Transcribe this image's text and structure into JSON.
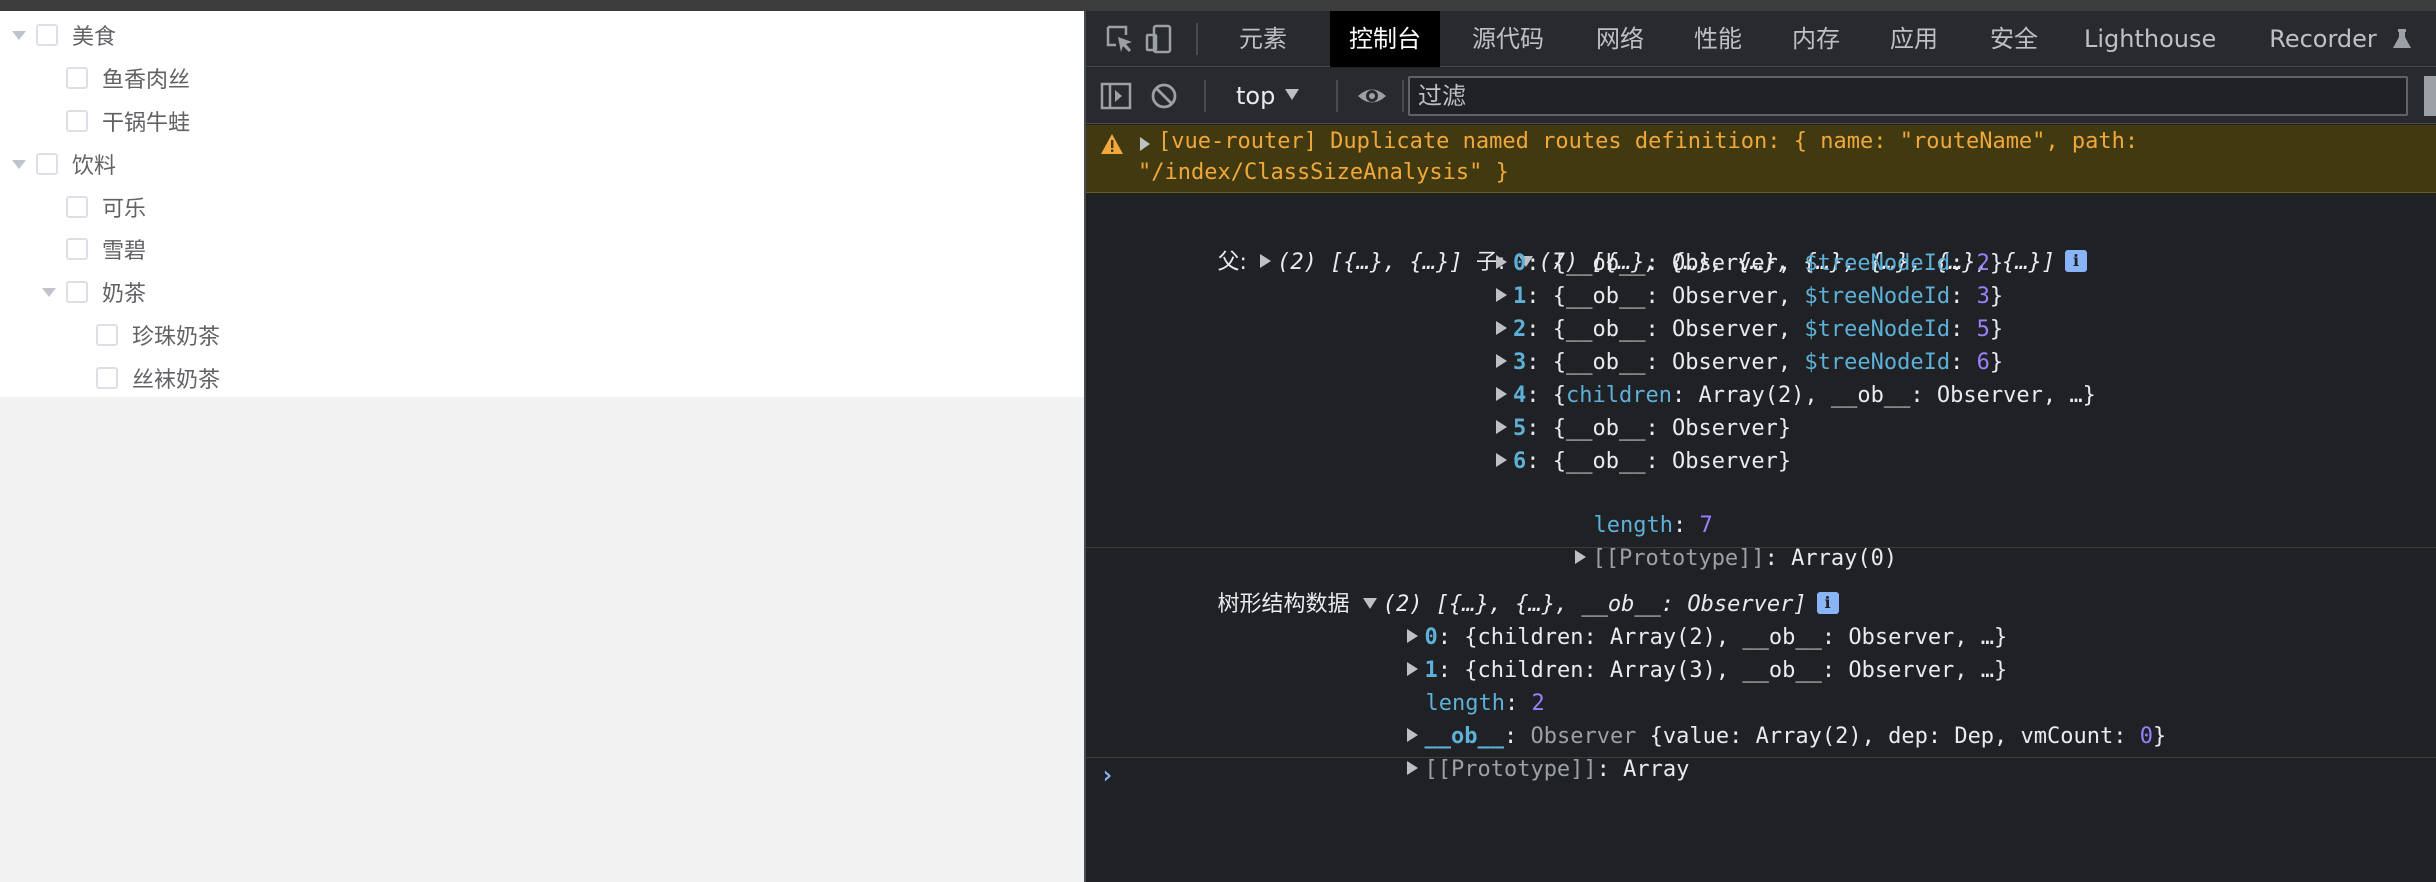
{
  "tree": {
    "nodes": [
      {
        "label": "美食",
        "level": 0,
        "expanded": true,
        "has_children": true
      },
      {
        "label": "鱼香肉丝",
        "level": 1,
        "has_children": false
      },
      {
        "label": "干锅牛蛙",
        "level": 1,
        "has_children": false
      },
      {
        "label": "饮料",
        "level": 0,
        "expanded": true,
        "has_children": true
      },
      {
        "label": "可乐",
        "level": 1,
        "has_children": false
      },
      {
        "label": "雪碧",
        "level": 1,
        "has_children": false
      },
      {
        "label": "奶茶",
        "level": 1,
        "expanded": true,
        "has_children": true
      },
      {
        "label": "珍珠奶茶",
        "level": 2,
        "has_children": false
      },
      {
        "label": "丝袜奶茶",
        "level": 2,
        "has_children": false
      }
    ]
  },
  "devtools": {
    "tabs": [
      {
        "label": "元素",
        "active": false
      },
      {
        "label": "控制台",
        "active": true
      },
      {
        "label": "源代码",
        "active": false
      },
      {
        "label": "网络",
        "active": false
      },
      {
        "label": "性能",
        "active": false
      },
      {
        "label": "内存",
        "active": false
      },
      {
        "label": "应用",
        "active": false
      },
      {
        "label": "安全",
        "active": false
      },
      {
        "label": "Lighthouse",
        "active": false
      },
      {
        "label": "Recorder",
        "active": false
      }
    ],
    "icons": {
      "inspect": "inspect-element-icon",
      "device": "device-toolbar-icon",
      "sidebar": "show-sidebar-icon",
      "clear": "clear-console-icon",
      "eye": "live-expression-icon",
      "recorder": "flask-icon",
      "warning": "warning-icon"
    },
    "toolbar": {
      "context": "top",
      "filter_placeholder": "过滤"
    },
    "colors": {
      "background": "#202124",
      "warning_bg": "#413a10",
      "warning_text": "#f2a73a",
      "key": "#5db0d7",
      "number": "#9980ff",
      "accent": "#8ab4f8"
    },
    "console": {
      "warning": {
        "line1": "[vue-router] Duplicate named routes definition: { name: \"routeName\", path:",
        "line2": "\"/index/ClassSizeAnalysis\" }"
      },
      "log1": {
        "label_parent": "父:",
        "parent_preview": "(2) [{…}, {…}]",
        "label_child": "子:",
        "child_preview": "(7) [{…}, {…}, {…}, {…}, {…}, {…}, {…}]",
        "items": [
          {
            "idx": "0",
            "prefix": "{__ob__: Observer, ",
            "key2": "$treeNodeId",
            "sep": ": ",
            "num": "2",
            "suffix": "}"
          },
          {
            "idx": "1",
            "prefix": "{__ob__: Observer, ",
            "key2": "$treeNodeId",
            "sep": ": ",
            "num": "3",
            "suffix": "}"
          },
          {
            "idx": "2",
            "prefix": "{__ob__: Observer, ",
            "key2": "$treeNodeId",
            "sep": ": ",
            "num": "5",
            "suffix": "}"
          },
          {
            "idx": "3",
            "prefix": "{__ob__: Observer, ",
            "key2": "$treeNodeId",
            "sep": ": ",
            "num": "6",
            "suffix": "}"
          },
          {
            "idx": "4",
            "prefix": "{",
            "key2": "children",
            "sep": ": ",
            "num": "",
            "suffix": "Array(2), __ob__: Observer, …}"
          },
          {
            "idx": "5",
            "prefix": "{__ob__: Observer}",
            "key2": "",
            "sep": "",
            "num": "",
            "suffix": ""
          },
          {
            "idx": "6",
            "prefix": "{__ob__: Observer}",
            "key2": "",
            "sep": "",
            "num": "",
            "suffix": ""
          }
        ],
        "length_key": "length",
        "length_val": "7",
        "proto_key": "[[Prototype]]",
        "proto_val": "Array(0)"
      },
      "log2": {
        "label": "树形结构数据",
        "preview": "(2) [{…}, {…}, __ob__: Observer]",
        "item0_idx": "0",
        "item0_val": "{children: Array(2), __ob__: Observer, …}",
        "item1_idx": "1",
        "item1_val": "{children: Array(3), __ob__: Observer, …}",
        "length_key": "length",
        "length_val": "2",
        "ob_key": "__ob__",
        "ob_class": "Observer",
        "ob_val_a": " {value: Array(2), dep: Dep, vmCount: ",
        "ob_num": "0",
        "ob_val_b": "}",
        "proto_key": "[[Prototype]]",
        "proto_val": "Array"
      },
      "prompt": "›"
    }
  }
}
